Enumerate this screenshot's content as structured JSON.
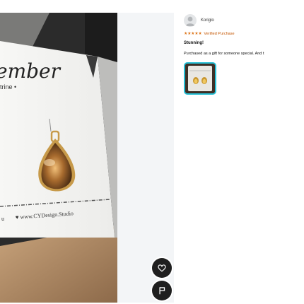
{
  "review": {
    "reviewer_name": "Koriglo",
    "stars": "★★★★★",
    "rating": 5,
    "verified_label": "Verified Purchase",
    "title": "Stunning!",
    "body": "Purchased as a gift for someone special. And t"
  },
  "photo": {
    "card_script_text": "ember",
    "card_subtitle": "trine •",
    "card_website": "♥ www.CYDesign.Studio",
    "card_left_fragment": "u"
  },
  "actions": {
    "like_icon": "heart-icon",
    "report_icon": "flag-icon"
  },
  "colors": {
    "star": "#de7921",
    "verified": "#c45500",
    "thumb_border": "#27c0d6",
    "action_button": "#1f1f1f"
  }
}
